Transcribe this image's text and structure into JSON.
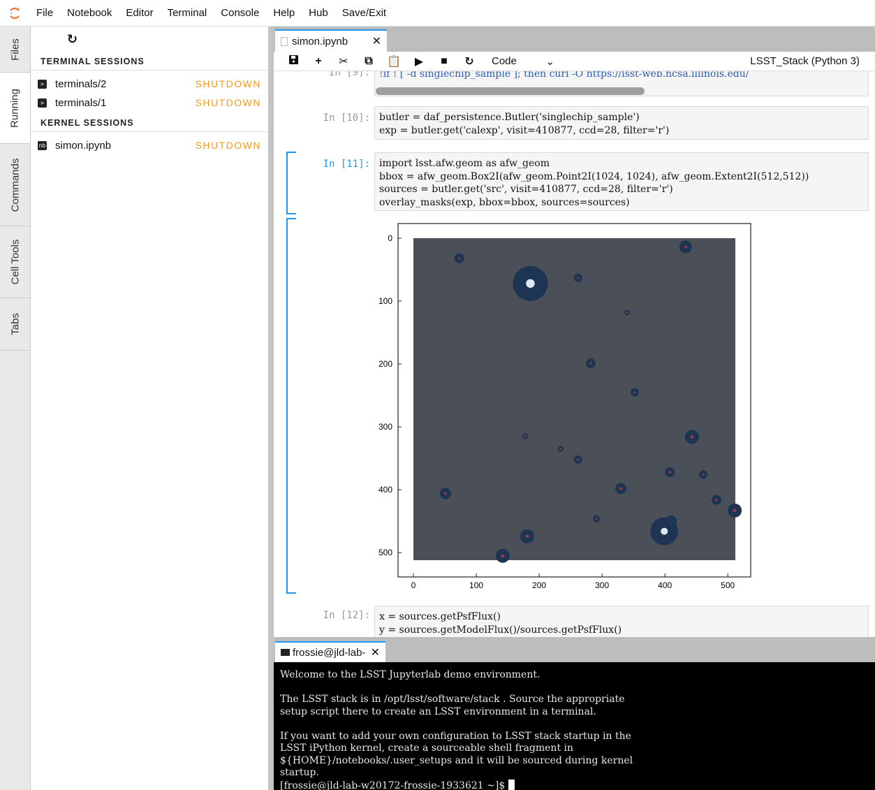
{
  "menu": [
    "File",
    "Notebook",
    "Editor",
    "Terminal",
    "Console",
    "Help",
    "Hub",
    "Save/Exit"
  ],
  "side_tabs": [
    "Files",
    "Running",
    "Commands",
    "Cell Tools",
    "Tabs"
  ],
  "running": {
    "terminal_title": "TERMINAL SESSIONS",
    "kernel_title": "KERNEL SESSIONS",
    "shutdown": "SHUTDOWN",
    "terminals": [
      "terminals/2",
      "terminals/1"
    ],
    "kernels": [
      "simon.ipynb"
    ]
  },
  "notebook": {
    "tab_title": "simon.ipynb",
    "cell_type": "Code",
    "kernel": "LSST_Stack (Python 3)",
    "cells": [
      {
        "prompt": "In [9]:",
        "code": "!if ! [ -d singlechip_sample ]; then curl -O https://lsst-web.ncsa.illinois.edu/"
      },
      {
        "prompt": "In [10]:",
        "code_lines": [
          "butler = daf_persistence.Butler('singlechip_sample')",
          "exp = butler.get('calexp', visit=410877, ccd=28, filter='r')"
        ]
      },
      {
        "prompt": "In [11]:",
        "code_lines": [
          "import lsst.afw.geom as afw_geom",
          "bbox = afw_geom.Box2I(afw_geom.Point2I(1024, 1024), afw_geom.Extent2I(512,512))",
          "sources = butler.get('src', visit=410877, ccd=28, filter='r')",
          "overlay_masks(exp, bbox=bbox, sources=sources)"
        ]
      },
      {
        "prompt": "In [12]:",
        "code_lines": [
          "x = sources.getPsfFlux()",
          "y = sources.getModelFlux()/sources.getPsfFlux()"
        ]
      }
    ]
  },
  "plot": {
    "xticks": [
      "0",
      "100",
      "200",
      "300",
      "400",
      "500"
    ],
    "yticks": [
      "0",
      "100",
      "200",
      "300",
      "400",
      "500"
    ]
  },
  "terminal": {
    "tab_title": "frossie@jld-lab-",
    "lines": [
      "Welcome to the LSST Jupyterlab demo environment.",
      "",
      "The LSST stack is in /opt/lsst/software/stack . Source the appropriate",
      "setup script there to create an LSST environment in a terminal.",
      "",
      "If you want to add your own configuration to LSST stack startup in the",
      "LSST iPython kernel, create a sourceable shell fragment in",
      "${HOME}/notebooks/.user_setups and it will be sourced during kernel",
      "startup."
    ],
    "prompt": "[frossie@jld-lab-w20172-frossie-1933621 ~]$ "
  }
}
